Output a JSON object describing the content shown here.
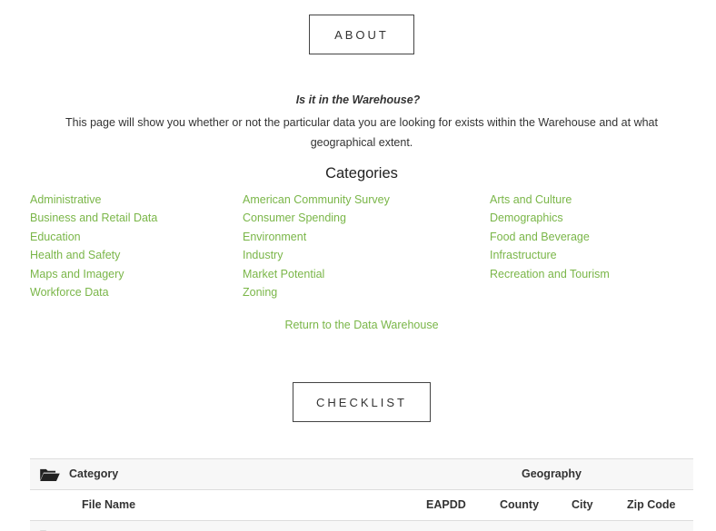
{
  "about": {
    "label": "ABOUT"
  },
  "intro": {
    "question": "Is it in the Warehouse?",
    "text": "This page will show you whether or not the particular data you are looking for exists within the Warehouse and at what geographical extent."
  },
  "categories": {
    "title": "Categories",
    "columns": [
      [
        "Administrative",
        "Business and Retail Data",
        "Education",
        "Health and Safety",
        "Maps and Imagery",
        "Workforce Data"
      ],
      [
        "American Community Survey",
        "Consumer Spending",
        "Environment",
        "Industry",
        "Market Potential",
        "Zoning"
      ],
      [
        "Arts and Culture",
        "Demographics",
        "Food and Beverage",
        "Infrastructure",
        "Recreation and Tourism"
      ]
    ],
    "link_color": "#7ab648"
  },
  "return_link": "Return to the Data Warehouse",
  "checklist": {
    "label": "CHECKLIST"
  },
  "table": {
    "header": {
      "category": "Category",
      "geography": "Geography"
    },
    "subheader": {
      "file_name": "File Name",
      "eapdd": "EAPDD",
      "county": "County",
      "city": "City",
      "zip_code": "Zip Code"
    },
    "icon": "folder-open-icon"
  }
}
